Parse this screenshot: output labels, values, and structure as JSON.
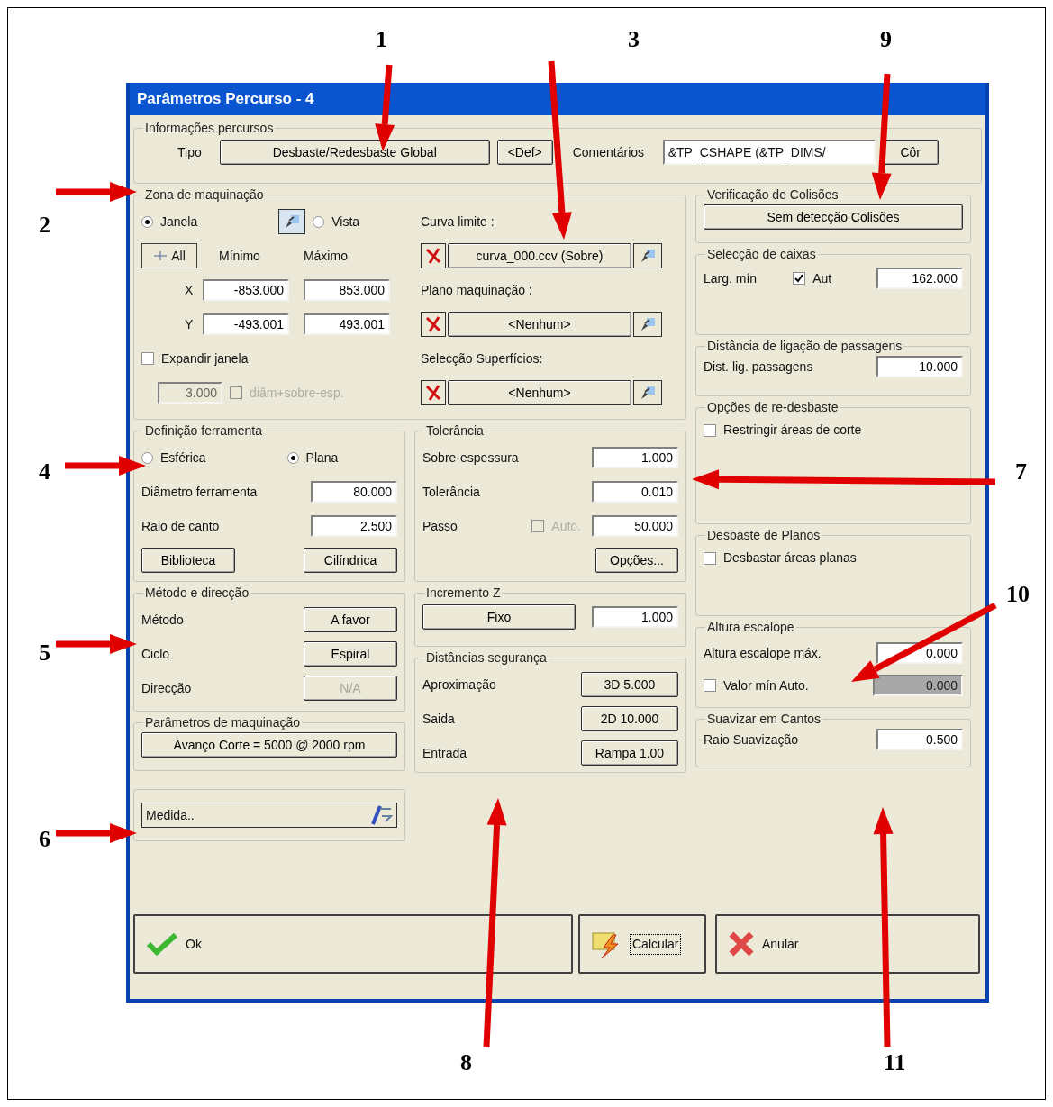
{
  "annotations": [
    {
      "label": "1"
    },
    {
      "label": "3"
    },
    {
      "label": "9"
    },
    {
      "label": "2"
    },
    {
      "label": "4"
    },
    {
      "label": "7"
    },
    {
      "label": "10"
    },
    {
      "label": "5"
    },
    {
      "label": "6"
    },
    {
      "label": "8"
    },
    {
      "label": "11"
    }
  ],
  "window": {
    "title": "Parâmetros Percurso - 4"
  },
  "info": {
    "title": "Informações percursos",
    "tipo_label": "Tipo",
    "tipo_button": "Desbaste/Redesbaste Global",
    "def_button": "<Def>",
    "comments_label": "Comentários",
    "comments_value": "&TP_CSHAPE (&TP_DIMS/",
    "color_button": "Côr"
  },
  "zona": {
    "title": "Zona de maquinação",
    "radios": [
      {
        "label": "Janela",
        "selected": true
      },
      {
        "label": "Vista",
        "selected": false
      }
    ],
    "all_button": "All",
    "min_header": "Mínimo",
    "max_header": "Máximo",
    "rows": [
      {
        "axis": "X",
        "min": "-853.000",
        "max": "853.000"
      },
      {
        "axis": "Y",
        "min": "-493.001",
        "max": "493.001"
      }
    ],
    "expand": {
      "label": "Expandir janela",
      "checked": false
    },
    "expand_value": {
      "value": "3.000",
      "disabled": true
    },
    "diam": {
      "label": "diâm+sobre-esp.",
      "checked": false,
      "disabled": true
    },
    "selectors": [
      {
        "label": "Curva limite :",
        "value": "curva_000.ccv (Sobre)"
      },
      {
        "label": "Plano maquinação :",
        "value": "<Nenhum>"
      },
      {
        "label": "Selecção Superfícios:",
        "value": "<Nenhum>"
      }
    ]
  },
  "ferramenta": {
    "title": "Definição ferramenta",
    "radios": [
      {
        "label": "Esférica",
        "selected": false
      },
      {
        "label": "Plana",
        "selected": true
      }
    ],
    "fields": [
      {
        "label": "Diâmetro ferramenta",
        "value": "80.000"
      },
      {
        "label": "Raio de canto",
        "value": "2.500"
      }
    ],
    "buttons": [
      "Biblioteca",
      "Cilíndrica"
    ]
  },
  "tolerancia": {
    "title": "Tolerância",
    "fields": [
      {
        "label": "Sobre-espessura",
        "value": "1.000"
      },
      {
        "label": "Tolerância",
        "value": "0.010"
      },
      {
        "label": "Passo",
        "value": "50.000",
        "auto": {
          "label": "Auto.",
          "checked": false,
          "disabled": true
        }
      }
    ],
    "button": "Opções..."
  },
  "metodo": {
    "title": "Método e direcção",
    "rows": [
      {
        "label": "Método",
        "value": "A favor",
        "disabled": false
      },
      {
        "label": "Ciclo",
        "value": "Espiral",
        "disabled": false
      },
      {
        "label": "Direcção",
        "value": "N/A",
        "disabled": true
      }
    ]
  },
  "incremento": {
    "title": "Incremento Z",
    "button": "Fixo",
    "value": "1.000"
  },
  "distancias": {
    "title": "Distâncias segurança",
    "rows": [
      {
        "label": "Aproximação",
        "value": "3D 5.000"
      },
      {
        "label": "Saida",
        "value": "2D 10.000"
      },
      {
        "label": "Entrada",
        "value": "Rampa 1.00"
      }
    ]
  },
  "parametros": {
    "title": "Parâmetros de maquinação",
    "button": "Avanço Corte = 5000 @ 2000 rpm"
  },
  "medida": {
    "value": "Medida.."
  },
  "colisoes": {
    "title": "Verificação de Colisões",
    "button": "Sem detecção Colisões"
  },
  "caixas": {
    "title": "Selecção de caixas",
    "label": "Larg. mín",
    "auto": {
      "label": "Aut",
      "checked": true
    },
    "value": "162.000"
  },
  "ligacao": {
    "title": "Distância de ligação de passagens",
    "label": "Dist. lig. passagens",
    "value": "10.000"
  },
  "redesbaste": {
    "title": "Opções de re-desbaste",
    "check": {
      "label": "Restringir áreas de corte",
      "checked": false
    }
  },
  "planos": {
    "title": "Desbaste de Planos",
    "check": {
      "label": "Desbastar áreas planas",
      "checked": false
    }
  },
  "escalope": {
    "title": "Altura escalope",
    "label": "Altura escalope máx.",
    "value": "0.000",
    "auto": {
      "label": "Valor mín Auto.",
      "checked": false
    },
    "min_value": {
      "value": "0.000",
      "disabled": true
    }
  },
  "suavizar": {
    "title": "Suavizar em Cantos",
    "label": "Raio Suavização",
    "value": "0.500"
  },
  "footer": [
    {
      "kind": "ok",
      "label": "Ok",
      "focused": false
    },
    {
      "kind": "calc",
      "label": "Calcular",
      "focused": true
    },
    {
      "kind": "cancel",
      "label": "Anular",
      "focused": false
    }
  ]
}
